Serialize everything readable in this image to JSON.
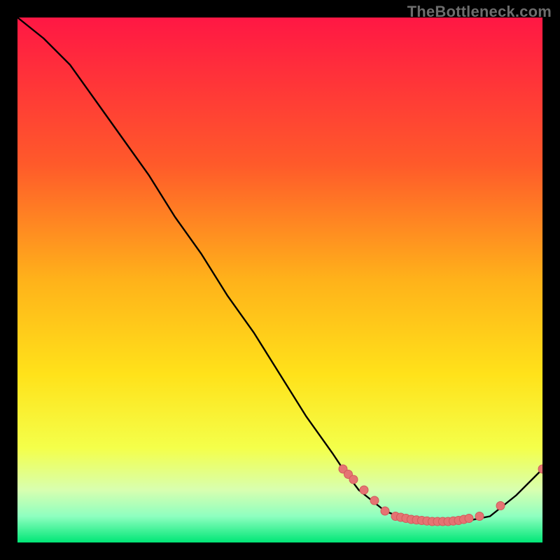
{
  "watermark": "TheBottleneck.com",
  "colors": {
    "background": "#000000",
    "gradient_top": "#ff1744",
    "gradient_mid_top": "#ff8a1f",
    "gradient_mid": "#ffe21a",
    "gradient_low": "#e4ff60",
    "gradient_bottom_top": "#b6ffb6",
    "gradient_bottom": "#00e676",
    "curve": "#000000",
    "marker_fill": "#e57373",
    "marker_stroke": "#d15b5b",
    "watermark_text": "#6d6d6d"
  },
  "chart_data": {
    "type": "line",
    "title": "",
    "xlabel": "",
    "ylabel": "",
    "xlim": [
      0,
      100
    ],
    "ylim": [
      0,
      100
    ],
    "series": [
      {
        "name": "bottleneck-curve",
        "x": [
          0,
          5,
          10,
          15,
          20,
          25,
          30,
          35,
          40,
          45,
          50,
          55,
          60,
          62,
          65,
          70,
          75,
          80,
          85,
          90,
          95,
          100
        ],
        "y": [
          100,
          96,
          91,
          84,
          77,
          70,
          62,
          55,
          47,
          40,
          32,
          24,
          17,
          14,
          10,
          6,
          4,
          4,
          4,
          5,
          9,
          14
        ]
      }
    ],
    "markers": {
      "name": "highlight-points",
      "x": [
        62,
        63,
        64,
        66,
        68,
        70,
        72,
        73,
        74,
        75,
        76,
        77,
        78,
        79,
        80,
        81,
        82,
        83,
        84,
        85,
        86,
        88,
        92,
        100
      ],
      "y": [
        14,
        13,
        12,
        10,
        8,
        6,
        5,
        4.8,
        4.6,
        4.4,
        4.3,
        4.2,
        4.1,
        4.0,
        4.0,
        4.0,
        4.0,
        4.1,
        4.2,
        4.4,
        4.6,
        5,
        7,
        14
      ]
    }
  }
}
